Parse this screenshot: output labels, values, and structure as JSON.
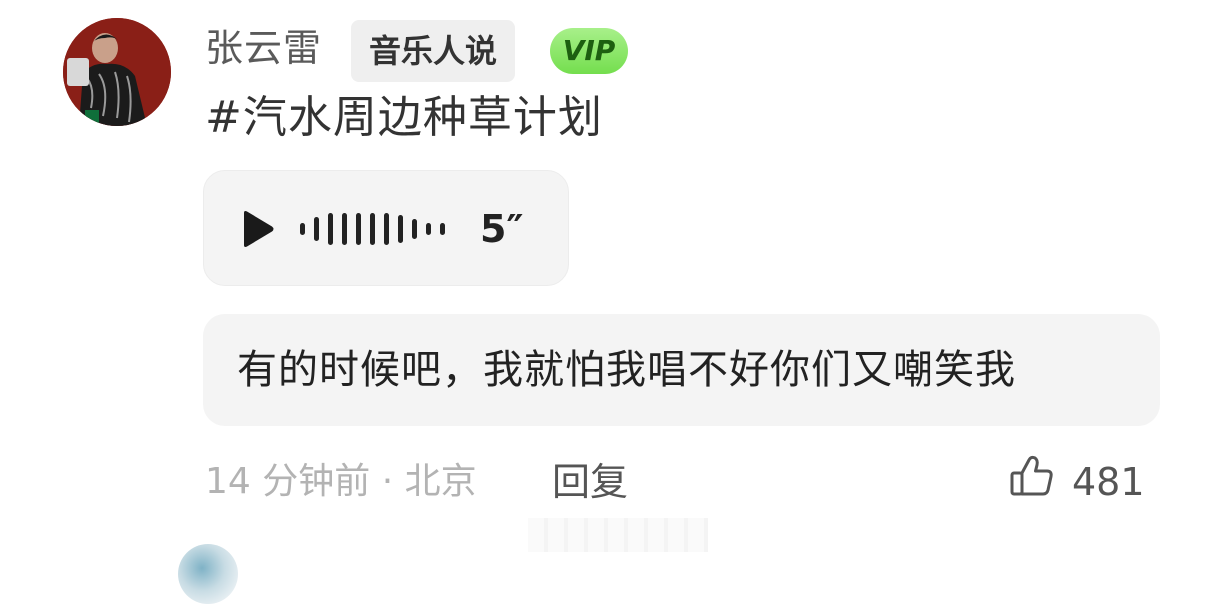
{
  "user": {
    "name": "张云雷",
    "tag": "音乐人说",
    "vip": "VIP"
  },
  "topic": "#汽水周边种草计划",
  "voice": {
    "duration": "5″"
  },
  "comment": {
    "text": "有的时候吧，我就怕我唱不好你们又嘲笑我"
  },
  "meta": {
    "time": "14 分钟前",
    "location": "北京",
    "reply": "回复",
    "likes": "481"
  },
  "icons": {
    "play": "play-icon",
    "like": "thumbs-up-icon"
  },
  "colors": {
    "vip_badge": "#7ce353",
    "bubble": "#f4f4f4"
  }
}
